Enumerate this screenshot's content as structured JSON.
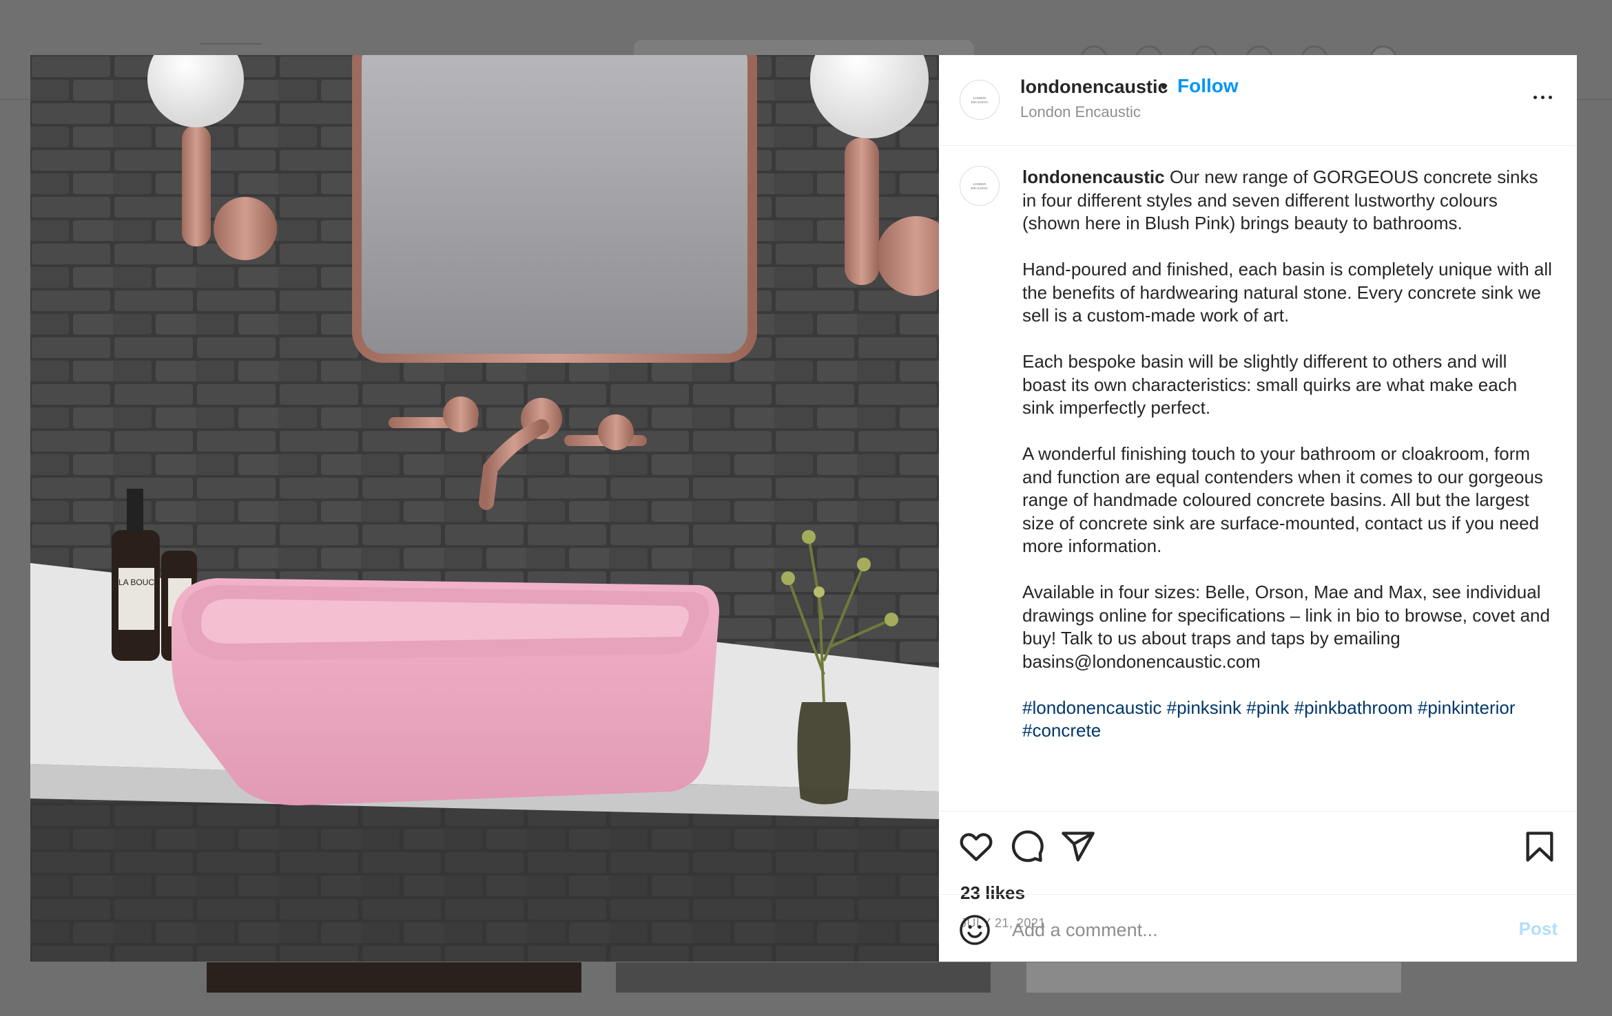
{
  "colors": {
    "link": "#0095f6",
    "hashtag": "#00376b",
    "muted": "#8e8e8e",
    "text": "#262626",
    "post_disabled": "#b2dffc",
    "sink": "#e9a9c0",
    "brick": "#3f3f3f",
    "copper": "#c08a7c"
  },
  "post": {
    "username": "londonencaustic",
    "follow_label": "Follow",
    "separator": "•",
    "subtitle": "London Encaustic",
    "avatar_text": "LONDON ENCAUSTIC",
    "more_icon": "more-options-icon"
  },
  "caption": {
    "username": "londonencaustic",
    "paragraph_1": "Our new range of GORGEOUS concrete sinks in four different styles and seven different lustworthy colours (shown here in Blush Pink) brings beauty to bathrooms.",
    "paragraph_2": "Hand-poured and finished, each basin is completely unique with all the benefits of hardwearing natural stone. Every concrete sink we sell is a custom-made work of art.",
    "paragraph_3": "Each bespoke basin will be slightly different to others and will boast its own characteristics: small quirks are what make each sink imperfectly perfect.",
    "paragraph_4": "A wonderful finishing touch to your bathroom or cloakroom, form and function are equal contenders when it comes to our gorgeous range of handmade coloured concrete basins. All but the largest size of concrete sink are surface-mounted, contact us if you need more information.",
    "paragraph_5": "Available in four sizes: Belle, Orson, Mae and Max, see individual drawings online for specifications – link in bio to browse, covet and buy! Talk to us about traps and taps by emailing basins@londonencaustic.com",
    "hashtags": [
      "#londonencaustic",
      "#pinksink",
      "#pink",
      "#pinkbathroom",
      "#pinkinterior",
      "#concrete"
    ]
  },
  "actions": {
    "icons": [
      "heart-icon",
      "comment-icon",
      "share-icon",
      "bookmark-icon"
    ],
    "likes": "23 likes",
    "date": "JULY 21, 2021"
  },
  "comment": {
    "placeholder": "Add a comment...",
    "post_label": "Post",
    "emoji_icon": "emoji-icon"
  },
  "photo": {
    "bottle_label": "LA BOUC"
  }
}
